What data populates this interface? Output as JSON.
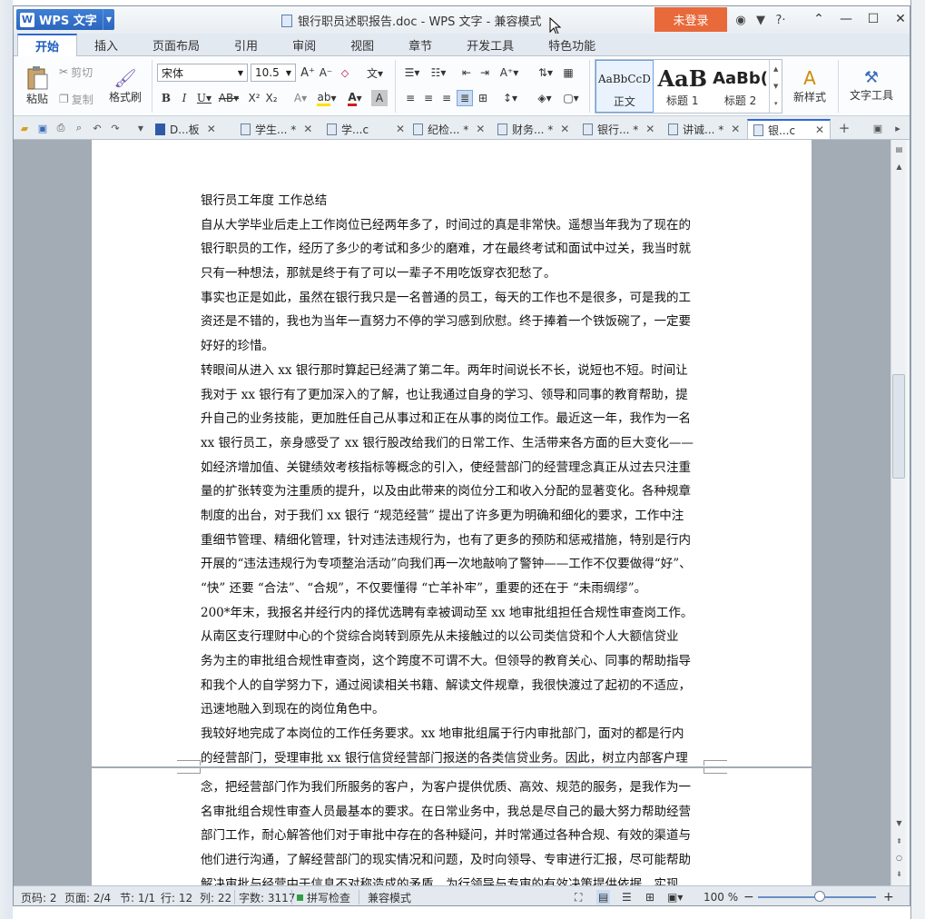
{
  "app": {
    "name": "WPS 文字",
    "window_title": "银行职员述职报告.doc - WPS 文字 - 兼容模式",
    "login": "未登录"
  },
  "menu_tabs": [
    "开始",
    "插入",
    "页面布局",
    "引用",
    "审阅",
    "视图",
    "章节",
    "开发工具",
    "特色功能"
  ],
  "ribbon": {
    "paste": "粘贴",
    "cut": "剪切",
    "copy": "复制",
    "format_painter": "格式刷",
    "font_name": "宋体",
    "font_size": "10.5",
    "styles": [
      {
        "preview": "AaBbCcD",
        "label": "正文"
      },
      {
        "preview": "AaB",
        "label": "标题 1"
      },
      {
        "preview": "AaBb(",
        "label": "标题 2"
      }
    ],
    "new_style": "新样式",
    "text_tools": "文字工具"
  },
  "doc_tabs": [
    "D...板",
    "学生... *",
    "学...c",
    "纪检... *",
    "财务... *",
    "银行... *",
    "讲诚... *",
    "银...c"
  ],
  "document": {
    "page1_lines": [
      "银行员工年度 工作总结",
      "自从大学毕业后走上工作岗位已经两年多了，时间过的真是非常快。遥想当年我为了现在的",
      "银行职员的工作，经历了多少的考试和多少的磨难，才在最终考试和面试中过关，我当时就",
      "只有一种想法，那就是终于有了可以一辈子不用吃饭穿衣犯愁了。",
      "事实也正是如此，虽然在银行我只是一名普通的员工，每天的工作也不是很多，可是我的工",
      "资还是不错的，我也为当年一直努力不停的学习感到欣慰。终于捧着一个铁饭碗了，一定要",
      "好好的珍惜。",
      "转眼间从进入 xx 银行那时算起已经满了第二年。两年时间说长不长，说短也不短。时间让",
      "我对于 xx 银行有了更加深入的了解，也让我通过自身的学习、领导和同事的教育帮助，提",
      "升自己的业务技能，更加胜任自己从事过和正在从事的岗位工作。最近这一年，我作为一名",
      "xx 银行员工，亲身感受了 xx 银行股改给我们的日常工作、生活带来各方面的巨大变化——",
      "如经济增加值、关键绩效考核指标等概念的引入，使经营部门的经营理念真正从过去只注重",
      "量的扩张转变为注重质的提升，以及由此带来的岗位分工和收入分配的显著变化。各种规章",
      "制度的出台，对于我们 xx 银行 “规范经营” 提出了许多更为明确和细化的要求，工作中注",
      "重细节管理、精细化管理，针对违法违规行为，也有了更多的预防和惩戒措施，特别是行内",
      "开展的“违法违规行为专项整治活动”向我们再一次地敲响了警钟——工作不仅要做得“好”、",
      "“快” 还要 “合法”、“合规”，不仅要懂得 “亡羊补牢”，重要的还在于 “未雨绸缪”。",
      "200*年末，我报名并经行内的择优选聘有幸被调动至 xx 地审批组担任合规性审查岗工作。",
      "从南区支行理财中心的个贷综合岗转到原先从未接触过的以公司类信贷和个人大额信贷业",
      "务为主的审批组合规性审查岗，这个跨度不可谓不大。但领导的教育关心、同事的帮助指导",
      "和我个人的自学努力下，通过阅读相关书籍、解读文件规章，我很快渡过了起初的不适应，",
      "迅速地融入到现在的岗位角色中。",
      "我较好地完成了本岗位的工作任务要求。xx 地审批组属于行内审批部门，面对的都是行内",
      "的经营部门，受理审批 xx 银行信贷经营部门报送的各类信贷业务。因此，树立内部客户理"
    ],
    "page2_lines": [
      "念，把经营部门作为我们所服务的客户，为客户提供优质、高效、规范的服务，是我作为一",
      "名审批组合规性审查人员最基本的要求。在日常业务中，我总是尽自己的最大努力帮助经营",
      "部门工作，耐心解答他们对于审批中存在的各种疑问，并时常通过各种合规、有效的渠道与",
      "他们进行沟通，了解经营部门的现实情况和问题，及时向领导、专审进行汇报，尽可能帮助",
      "解决审批与经营中于信息不对称造成的矛盾，为行领导与专审的有效决策提供依据，实现"
    ]
  },
  "status": {
    "page_code": "页码: 2",
    "page": "页面: 2/4",
    "section": "节: 1/1",
    "row": "行: 12",
    "col": "列: 22",
    "word_count": "字数: 3117",
    "spell_check": "拼写检查",
    "compat": "兼容模式",
    "zoom": "100 %"
  },
  "colors": {
    "accent": "#2e6ad0",
    "login": "#e8693a"
  }
}
